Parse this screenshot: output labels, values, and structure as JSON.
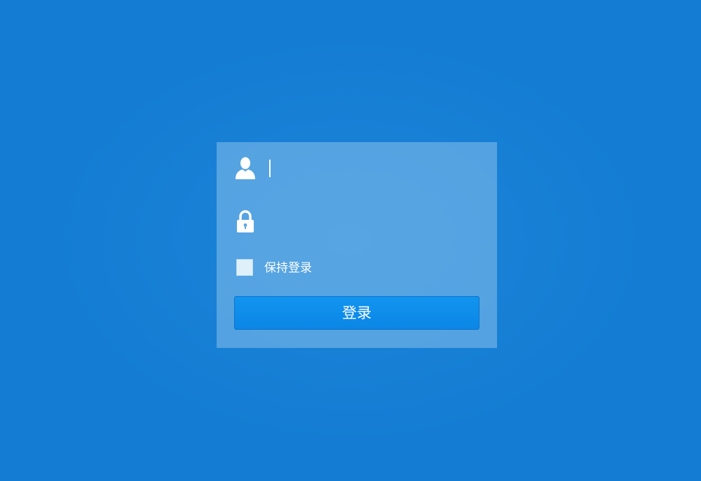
{
  "colors": {
    "background": "#147dd3",
    "panel": "#5da8e0",
    "button": "#0f8ceb",
    "text": "#ffffff"
  },
  "login": {
    "username": {
      "icon": "user-icon",
      "value": "",
      "placeholder": ""
    },
    "password": {
      "icon": "lock-icon",
      "value": "",
      "placeholder": ""
    },
    "remember_label": "保持登录",
    "remember_checked": false,
    "submit_label": "登录"
  }
}
